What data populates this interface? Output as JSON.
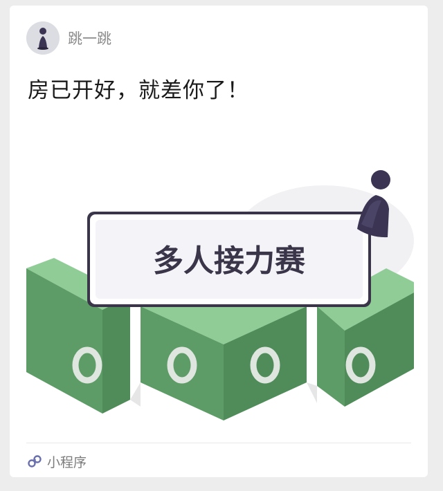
{
  "share_card": {
    "app_name": "跳一跳",
    "message": "房已开好，就差你了！",
    "banner_text": "多人接力赛",
    "footer_label": "小程序"
  },
  "icons": {
    "avatar": "chess-piece-icon",
    "footer": "mini-program-icon"
  },
  "colors": {
    "block_top": "#8fcc96",
    "block_left": "#5d9c66",
    "block_right": "#4f8c59",
    "piece": "#3b3553",
    "banner_border": "#3a3548"
  }
}
